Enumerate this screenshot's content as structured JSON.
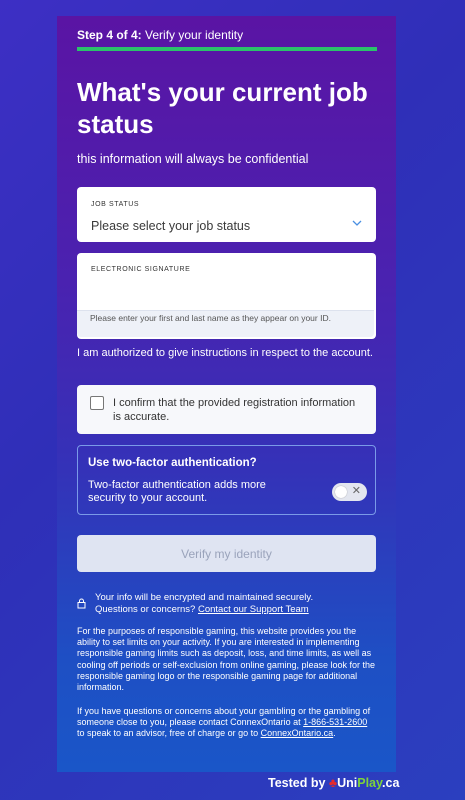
{
  "step": {
    "prefix": "Step 4 of 4:",
    "label": "Verify your identity"
  },
  "title": "What's your current job status",
  "subtitle": "this information will always be confidential",
  "job_status": {
    "label": "JOB STATUS",
    "value": "Please select your job status"
  },
  "signature": {
    "label": "ELECTRONIC SIGNATURE",
    "value": "",
    "help": "Please enter your first and last name as they appear on your ID."
  },
  "authorized_text": "I am authorized to give instructions in respect to the account.",
  "confirm": {
    "checked": false,
    "text": "I confirm that the provided registration information is accurate."
  },
  "two_factor": {
    "title": "Use two-factor authentication?",
    "description": "Two-factor authentication adds more security to your account.",
    "enabled": false,
    "toggle_icon": "x-mark-icon"
  },
  "verify_button": "Verify my identity",
  "secure": {
    "icon": "lock-icon",
    "line1": "Your info will be encrypted and maintained securely.",
    "line2_prefix": "Questions or concerns?",
    "link": "Contact our Support Team"
  },
  "responsible_gaming": "For the purposes of responsible gaming, this website provides you the ability to set limits on your activity. If you are interested in implementing responsible gaming limits such as deposit, loss, and time limits, as well as cooling off periods or self-exclusion from online gaming, please look for the responsible gaming logo or the responsible gaming page for additional information.",
  "contact": {
    "prefix": "If you have questions or concerns about your gambling or the gambling of someone close to you, please contact ConnexOntario at",
    "phone": "1-866-531-2600",
    "middle": "to speak to an advisor, free of charge or go to",
    "site": "ConnexOntario.ca",
    "suffix": "."
  },
  "badge": {
    "tested_by": "Tested by",
    "brand_uni": "Uni",
    "brand_play": "Play",
    "brand_tld": ".ca"
  },
  "colors": {
    "progress": "#2bc26b",
    "panel_top": "#5a14a4",
    "panel_bottom": "#1a56c8"
  }
}
